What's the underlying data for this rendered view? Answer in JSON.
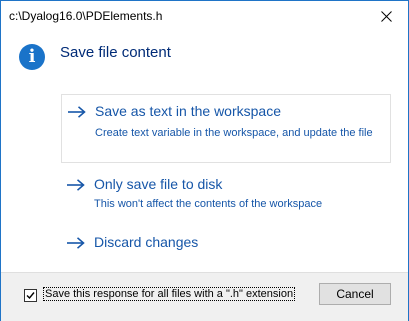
{
  "window": {
    "title": "c:\\Dyalog16.0\\PDElements.h"
  },
  "dialog": {
    "icon": "info-icon",
    "main_instruction": "Save file content",
    "accent_color": "#1656a8",
    "commands": [
      {
        "label": "Save as text in the workspace",
        "description": "Create text variable in the workspace, and update the file"
      },
      {
        "label": "Only save file to disk",
        "description": "This won't affect the contents of the workspace"
      },
      {
        "label": "Discard changes",
        "description": ""
      }
    ]
  },
  "footer": {
    "checkbox_label": "Save this response for all files with a \".h\" extension",
    "checkbox_checked": true,
    "cancel_label": "Cancel"
  }
}
